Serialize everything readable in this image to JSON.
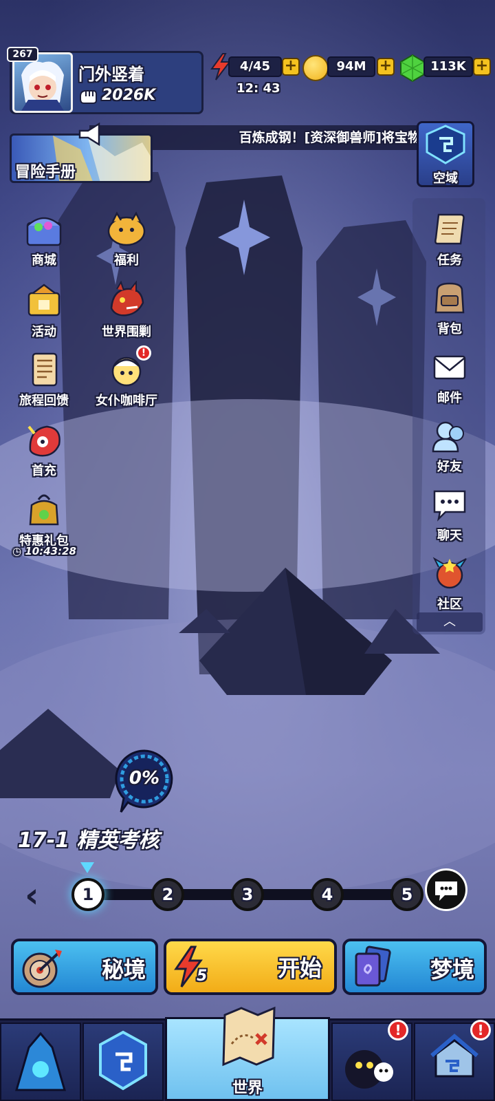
{
  "player": {
    "name": "门外竖着",
    "level": "267",
    "power": "2026K"
  },
  "resources": {
    "energy": "4/45",
    "energy_timer": "12: 43",
    "gold": "94M",
    "gems": "113K"
  },
  "notice": "百炼成钢！[资深御兽师]将宝物",
  "adventure_manual": "冒险手册",
  "space_domain": "空域",
  "left_menu": [
    {
      "label": "商城",
      "icon": "treasure-chest-icon"
    },
    {
      "label": "福利",
      "icon": "lucky-cat-icon"
    },
    {
      "label": "活动",
      "icon": "event-icon"
    },
    {
      "label": "世界围剿",
      "icon": "dragon-icon"
    },
    {
      "label": "旅程回馈",
      "icon": "scroll-icon"
    },
    {
      "label": "女仆咖啡厅",
      "icon": "maid-icon"
    },
    {
      "label": "首充",
      "icon": "first-charge-icon"
    },
    {
      "label": "特惠礼包",
      "icon": "gift-bag-icon"
    }
  ],
  "gift_timer": "10:43:28",
  "right_menu": [
    {
      "label": "任务",
      "icon": "quest-scroll-icon"
    },
    {
      "label": "背包",
      "icon": "backpack-icon"
    },
    {
      "label": "邮件",
      "icon": "mail-icon"
    },
    {
      "label": "好友",
      "icon": "friends-icon"
    },
    {
      "label": "聊天",
      "icon": "chat-icon"
    },
    {
      "label": "社区",
      "icon": "community-icon"
    }
  ],
  "progress": {
    "percent": "0%",
    "value": 0
  },
  "stage": {
    "title": "17-1 精英考核",
    "nodes": [
      "1",
      "2",
      "3",
      "4",
      "5"
    ],
    "current": 1
  },
  "actions": {
    "secret": "秘境",
    "start": "开始",
    "start_cost": "5",
    "dream": "梦境"
  },
  "bottom_nav": {
    "world": "世界"
  },
  "colors": {
    "accent_yellow": "#f4c21f",
    "accent_blue": "#3fa6e6",
    "badge_red": "#e32828",
    "panel_dark": "#1d2144"
  }
}
